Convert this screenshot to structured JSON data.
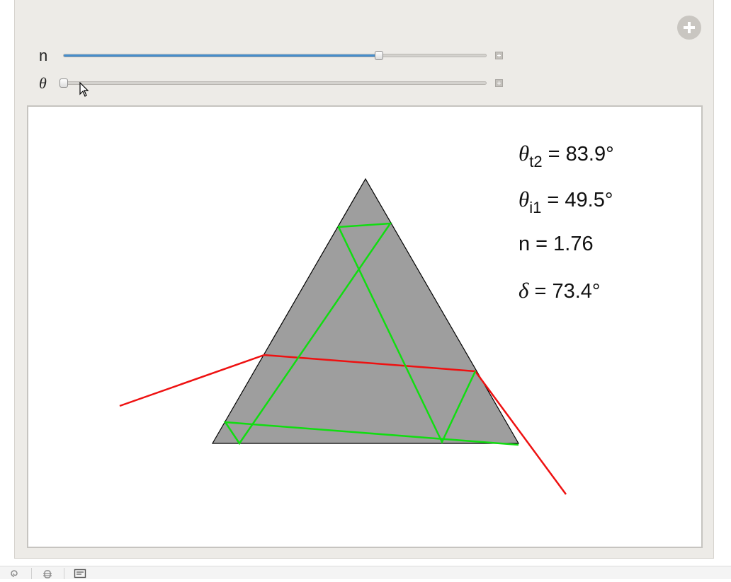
{
  "controls": {
    "n": {
      "label": "n",
      "fraction": 0.746
    },
    "theta": {
      "label": "θ",
      "fraction": 0.0
    }
  },
  "readouts": {
    "theta_t2": {
      "symbol": "θ",
      "sub": "t2",
      "text": " = 83.9°"
    },
    "theta_i1": {
      "symbol": "θ",
      "sub": "i1",
      "text": " = 49.5°"
    },
    "n": {
      "text": "n = 1.76"
    },
    "delta": {
      "symbol": "δ",
      "text": " = 73.4°"
    }
  },
  "colors": {
    "prism_fill": "#9e9e9e",
    "incident_ray": "#ee1111",
    "internal_ray": "#11dd11",
    "slider_fill": "#3a86c8"
  },
  "icons": {
    "expand": "plus-circle-icon",
    "slider_step": "plus-square-icon",
    "status": [
      "spiral-icon",
      "bug-icon",
      "note-icon"
    ]
  }
}
